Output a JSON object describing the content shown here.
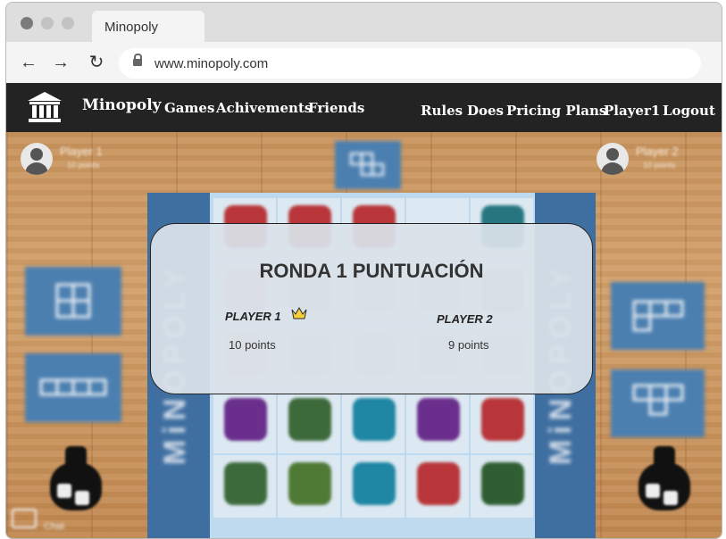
{
  "browser": {
    "tab_title": "Minopoly",
    "url": "www.minopoly.com",
    "controls": {
      "dots_color": "#7b7b7b"
    }
  },
  "nav": {
    "brand": "Minopoly",
    "left_links": [
      "Games",
      "Achivements",
      "Friends"
    ],
    "right_links": [
      "Rules",
      "Does",
      "Pricing Plans",
      "Player1",
      "Logout"
    ],
    "background": "#232323"
  },
  "game": {
    "player_left": {
      "name": "Player 1",
      "points": "10 points"
    },
    "player_right": {
      "name": "Player 2",
      "points": "10 points"
    },
    "side_text": "MiNOPOLY",
    "chat_label": "Chat",
    "board_accent": "#4b7fb0",
    "dice_colors": [
      "#b8363a",
      "#27767f",
      "#6a2f8c",
      "#3c6a3b",
      "#1f86a3"
    ]
  },
  "modal": {
    "title": "RONDA 1 PUNTUACIÓN",
    "player1": {
      "label": "PLAYER 1",
      "points": "10 points",
      "winner_icon": "crown-icon"
    },
    "player2": {
      "label": "PLAYER 2",
      "points": "9 points"
    }
  }
}
